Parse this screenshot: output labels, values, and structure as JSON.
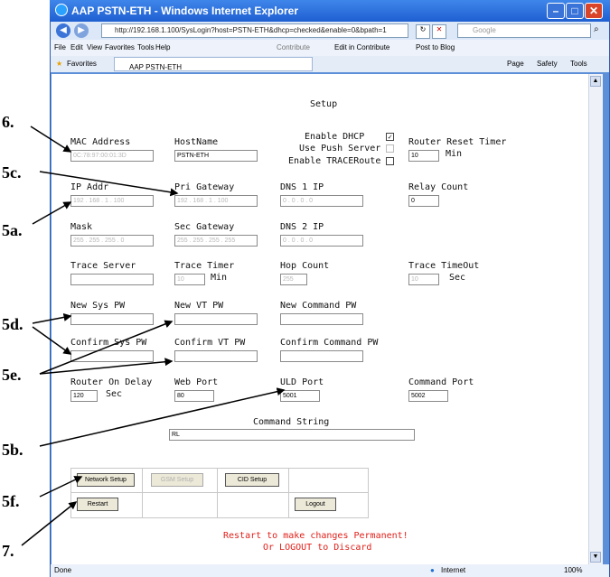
{
  "window": {
    "title": "AAP PSTN-ETH - Windows Internet Explorer"
  },
  "browser": {
    "address": "http://192.168.1.100/SysLogin?host=PSTN-ETH&dhcp=checked&enable=0&bpath=1",
    "search_placeholder": "Google",
    "menu": [
      "File",
      "Edit",
      "View",
      "Favorites",
      "Tools",
      "Help"
    ],
    "toolbar": [
      "Contribute",
      "Edit in Contribute",
      "Post to Blog"
    ],
    "favorites_label": "Favorites",
    "tab_title": "AAP PSTN-ETH",
    "right_tools": [
      "Page",
      "Safety",
      "Tools"
    ],
    "status_left": "Done",
    "status_zone": "Internet",
    "zoom": "100%"
  },
  "page": {
    "title": "Setup",
    "mac_label": "MAC Address",
    "mac_value": "0C:78:97:00:01:3D",
    "hostname_label": "HostName",
    "hostname_value": "PSTN-ETH",
    "dhcp_label": "Enable DHCP",
    "push_label": "Use Push Server",
    "trace_route_label": "Enable TRACERoute",
    "router_reset_label": "Router Reset Timer",
    "router_reset_value": "10",
    "min_label": "Min",
    "ip_label": "IP Addr",
    "ip_value": "192 . 168 . 1 . 100",
    "gateway_label": "Pri Gateway",
    "gateway_value": "192 . 168 . 1 . 100",
    "dns1_label": "DNS 1 IP",
    "dns1_value": "0 . 0 . 0 . 0",
    "relay_label": "Relay Count",
    "relay_value": "0",
    "mask_label": "Mask",
    "mask_value": "255 . 255 . 255 . 0",
    "sec_gateway_label": "Sec Gateway",
    "sec_gateway_value": "255 . 255 . 255 . 255",
    "dns2_label": "DNS 2 IP",
    "dns2_value": "0 . 0 . 0 . 0",
    "trace_server_label": "Trace Server",
    "trace_timer_label": "Trace Timer",
    "trace_timer_value": "10",
    "trace_timer_unit": "Min",
    "hop_label": "Hop Count",
    "hop_value": "255",
    "trace_timeout_label": "Trace TimeOut",
    "trace_timeout_value": "10",
    "sec_label": "Sec",
    "new_sys_pw_label": "New Sys PW",
    "new_vt_pw_label": "New VT PW",
    "new_cmd_pw_label": "New Command PW",
    "confirm_sys_pw_label": "Confirm Sys PW",
    "confirm_vt_pw_label": "Confirm VT PW",
    "confirm_cmd_pw_label": "Confirm Command PW",
    "router_on_delay_label": "Router On Delay",
    "router_on_delay_value": "120",
    "router_on_delay_unit": "Sec",
    "web_port_label": "Web Port",
    "web_port_value": "80",
    "uld_port_label": "ULD Port",
    "uld_port_value": "5001",
    "command_port_label": "Command Port",
    "command_port_value": "5002",
    "command_string_label": "Command String",
    "command_string_value": "RL",
    "network_setup_button": "Network Setup",
    "gsm_setup_button": "GSM Setup",
    "cid_setup_button": "CID Setup",
    "restart_button": "Restart",
    "logout_button": "Logout",
    "msg_line1": "Restart to make changes Permanent!",
    "msg_line2": "Or LOGOUT to Discard"
  },
  "annotations": [
    "6.",
    "5c.",
    "5a.",
    "5d.",
    "5e.",
    "5b.",
    "5f.",
    "7."
  ]
}
